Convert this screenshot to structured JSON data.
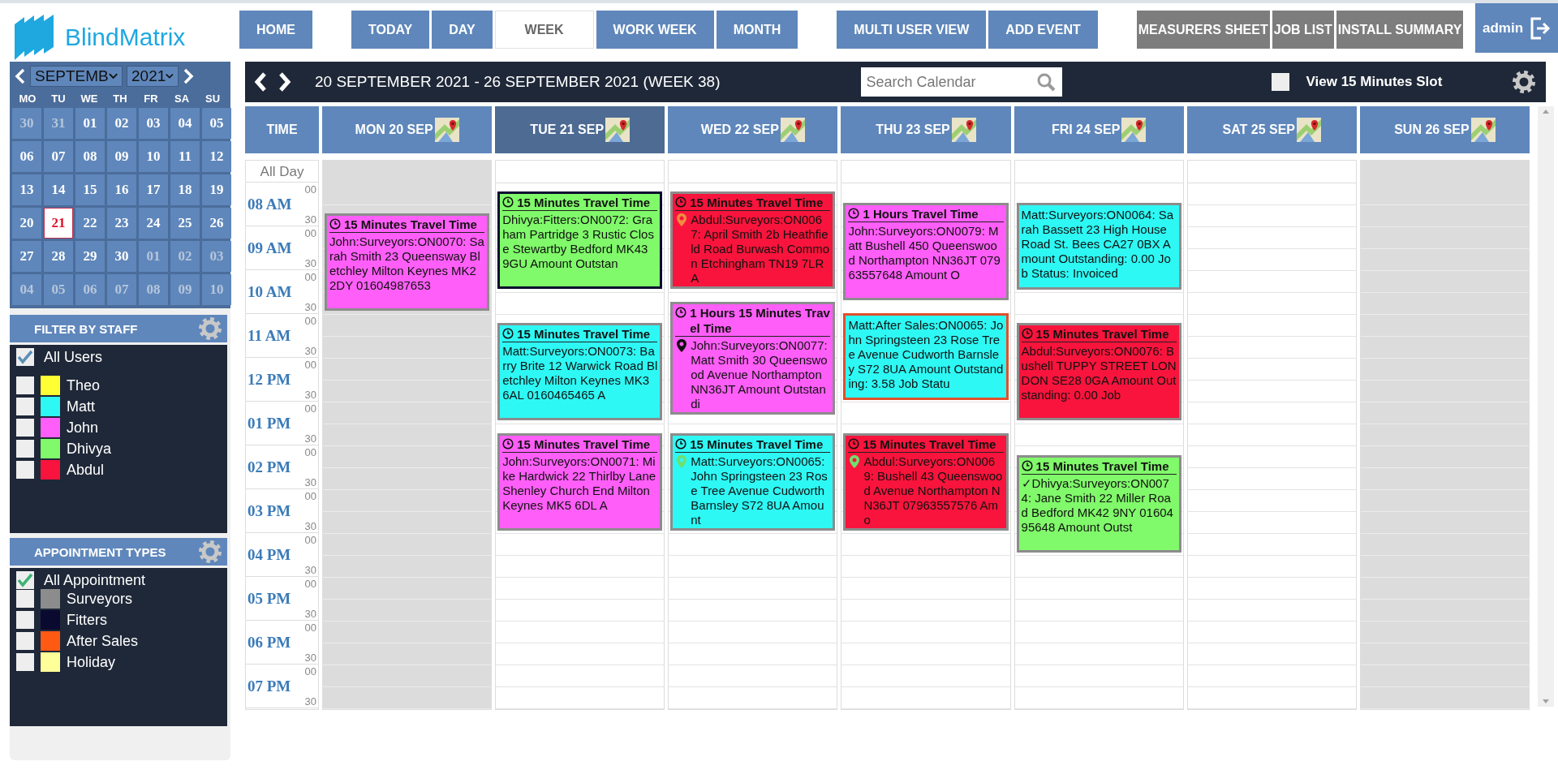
{
  "logo": {
    "text": "BlindMatrix"
  },
  "nav_groups": [
    {
      "kind": "primary",
      "buttons": [
        {
          "label": "HOME"
        }
      ]
    },
    {
      "kind": "views",
      "buttons": [
        {
          "label": "TODAY",
          "selected": false
        },
        {
          "label": "DAY",
          "selected": false
        },
        {
          "label": "WEEK",
          "selected": true
        },
        {
          "label": "WORK WEEK",
          "selected": false
        },
        {
          "label": "MONTH",
          "selected": false
        }
      ]
    },
    {
      "kind": "primary",
      "buttons": [
        {
          "label": "MULTI USER VIEW"
        },
        {
          "label": "ADD EVENT"
        }
      ]
    },
    {
      "kind": "report",
      "buttons": [
        {
          "label": "MEASURERS SHEET"
        },
        {
          "label": "JOB LIST"
        },
        {
          "label": "INSTALL SUMMARY"
        }
      ]
    }
  ],
  "user": {
    "name": "admin"
  },
  "mini_calendar": {
    "month": "SEPTEMB",
    "year": "2021",
    "weekdays": [
      "MO",
      "TU",
      "WE",
      "TH",
      "FR",
      "SA",
      "SU"
    ],
    "days": [
      {
        "label": "30",
        "other_month": true,
        "selected": false
      },
      {
        "label": "31",
        "other_month": true,
        "selected": false
      },
      {
        "label": "01",
        "other_month": false,
        "selected": false
      },
      {
        "label": "02",
        "other_month": false,
        "selected": false
      },
      {
        "label": "03",
        "other_month": false,
        "selected": false
      },
      {
        "label": "04",
        "other_month": false,
        "selected": false
      },
      {
        "label": "05",
        "other_month": false,
        "selected": false
      },
      {
        "label": "06",
        "other_month": false,
        "selected": false
      },
      {
        "label": "07",
        "other_month": false,
        "selected": false
      },
      {
        "label": "08",
        "other_month": false,
        "selected": false
      },
      {
        "label": "09",
        "other_month": false,
        "selected": false
      },
      {
        "label": "10",
        "other_month": false,
        "selected": false
      },
      {
        "label": "11",
        "other_month": false,
        "selected": false
      },
      {
        "label": "12",
        "other_month": false,
        "selected": false
      },
      {
        "label": "13",
        "other_month": false,
        "selected": false
      },
      {
        "label": "14",
        "other_month": false,
        "selected": false
      },
      {
        "label": "15",
        "other_month": false,
        "selected": false
      },
      {
        "label": "16",
        "other_month": false,
        "selected": false
      },
      {
        "label": "17",
        "other_month": false,
        "selected": false
      },
      {
        "label": "18",
        "other_month": false,
        "selected": false
      },
      {
        "label": "19",
        "other_month": false,
        "selected": false
      },
      {
        "label": "20",
        "other_month": false,
        "selected": false
      },
      {
        "label": "21",
        "other_month": false,
        "selected": true
      },
      {
        "label": "22",
        "other_month": false,
        "selected": false
      },
      {
        "label": "23",
        "other_month": false,
        "selected": false
      },
      {
        "label": "24",
        "other_month": false,
        "selected": false
      },
      {
        "label": "25",
        "other_month": false,
        "selected": false
      },
      {
        "label": "26",
        "other_month": false,
        "selected": false
      },
      {
        "label": "27",
        "other_month": false,
        "selected": false
      },
      {
        "label": "28",
        "other_month": false,
        "selected": false
      },
      {
        "label": "29",
        "other_month": false,
        "selected": false
      },
      {
        "label": "30",
        "other_month": false,
        "selected": false
      },
      {
        "label": "01",
        "other_month": true,
        "selected": false
      },
      {
        "label": "02",
        "other_month": true,
        "selected": false
      },
      {
        "label": "03",
        "other_month": true,
        "selected": false
      },
      {
        "label": "04",
        "other_month": true,
        "selected": false
      },
      {
        "label": "05",
        "other_month": true,
        "selected": false
      },
      {
        "label": "06",
        "other_month": true,
        "selected": false
      },
      {
        "label": "07",
        "other_month": true,
        "selected": false
      },
      {
        "label": "08",
        "other_month": true,
        "selected": false
      },
      {
        "label": "09",
        "other_month": true,
        "selected": false
      },
      {
        "label": "10",
        "other_month": true,
        "selected": false
      }
    ]
  },
  "staff_filter": {
    "title": "FILTER BY STAFF",
    "all": {
      "label": "All Users",
      "checked": true
    },
    "items": [
      {
        "name": "Theo",
        "color": "#ffff33",
        "checked": false
      },
      {
        "name": "Matt",
        "color": "#2ef8f4",
        "checked": false
      },
      {
        "name": "John",
        "color": "#ff5ef8",
        "checked": false
      },
      {
        "name": "Dhivya",
        "color": "#80f96a",
        "checked": false
      },
      {
        "name": "Abdul",
        "color": "#f8143c",
        "checked": false
      }
    ]
  },
  "appointment_types": {
    "title": "APPOINTMENT TYPES",
    "all": {
      "label": "All Appointment",
      "checked": true
    },
    "items": [
      {
        "name": "Surveyors",
        "color": "#8c8c8c",
        "checked": false
      },
      {
        "name": "Fitters",
        "color": "#0a0a30",
        "checked": false
      },
      {
        "name": "After Sales",
        "color": "#ff5a14",
        "checked": false
      },
      {
        "name": "Holiday",
        "color": "#ffff99",
        "checked": false
      }
    ]
  },
  "toolbar": {
    "range": "20 SEPTEMBER 2021 - 26 SEPTEMBER 2021 (WEEK 38)",
    "search": {
      "placeholder": "Search Calendar"
    },
    "slot_toggle": {
      "label": "View 15 Minutes Slot",
      "checked": false
    }
  },
  "calendar": {
    "time_heading": "TIME",
    "all_day_label": "All Day",
    "hours": [
      {
        "label": "08 AM",
        "marks": [
          "00",
          "30"
        ]
      },
      {
        "label": "09 AM",
        "marks": [
          "00",
          "30"
        ]
      },
      {
        "label": "10 AM",
        "marks": [
          "00",
          "30"
        ]
      },
      {
        "label": "11 AM",
        "marks": [
          "00",
          "30"
        ]
      },
      {
        "label": "12 PM",
        "marks": [
          "00",
          "30"
        ]
      },
      {
        "label": "01 PM",
        "marks": [
          "00",
          "30"
        ]
      },
      {
        "label": "02 PM",
        "marks": [
          "00",
          "30"
        ]
      },
      {
        "label": "03 PM",
        "marks": [
          "00",
          "30"
        ]
      },
      {
        "label": "04 PM",
        "marks": [
          "00",
          "30"
        ]
      },
      {
        "label": "05 PM",
        "marks": [
          "00",
          "30"
        ]
      },
      {
        "label": "06 PM",
        "marks": [
          "00",
          "30"
        ]
      },
      {
        "label": "07 PM",
        "marks": [
          "00",
          "30"
        ]
      }
    ],
    "days": [
      {
        "label": "MON 20 SEP",
        "selected": false,
        "shaded": true,
        "events": [
          {
            "color": "#ff5ef8",
            "outline": {
              "color": "#8c8c8c"
            },
            "title": "15 Minutes Travel Time",
            "text": "John:Surveyors:ON0070: Sarah Smith 23 Queensway Bletchley Milton Keynes MK2 2DY 01604987653"
          }
        ]
      },
      {
        "label": "TUE 21 SEP",
        "selected": true,
        "shaded": false,
        "events": [
          {
            "color": "#80f96a",
            "outline": {
              "color": "#0a0a30"
            },
            "title": "15 Minutes Travel Time",
            "text": "Dhivya:Fitters:ON0072: Graham Partridge 3 Rustic Close Stewartby Bedford MK43 9GU Amount Outstan"
          },
          {
            "color": "#2ef8f4",
            "outline": {
              "color": "#8c8c8c"
            },
            "title": "15 Minutes Travel Time",
            "text": "Matt:Surveyors:ON0073: Barry Brite 12 Warwick Road Bletchley Milton Keynes MK3 6AL 0160465465 A"
          },
          {
            "color": "#ff5ef8",
            "outline": {
              "color": "#8c8c8c"
            },
            "title": "15 Minutes Travel Time",
            "text": "John:Surveyors:ON0071: Mike Hardwick 22 Thirlby Lane Shenley Church End Milton Keynes MK5 6DL A"
          }
        ]
      },
      {
        "label": "WED 22 SEP",
        "selected": false,
        "shaded": false,
        "events": [
          {
            "color": "#f8143c",
            "outline": {
              "color": "#8c8c8c"
            },
            "title": "15 Minutes Travel Time",
            "pin": {
              "color": "#f08a40"
            },
            "text": "Abdul:Surveyors:ON0067: April Smith 2b Heathfield Road Burwash Common Etchingham TN19 7LR A"
          },
          {
            "color": "#ff5ef8",
            "outline": {
              "color": "#8c8c8c"
            },
            "title": "1 Hours 15 Minutes Travel Time",
            "pin": {
              "color": "#111111"
            },
            "text": "John:Surveyors:ON0077: Matt Smith 30 Queenswood Avenue Northampton NN36JT Amount Outstandi"
          },
          {
            "color": "#2ef8f4",
            "outline": {
              "color": "#8c8c8c"
            },
            "title": "15 Minutes Travel Time",
            "pin": {
              "color": "#6fe06f"
            },
            "text": "Matt:Surveyors:ON0065: John Springsteen 23 Rose Tree Avenue Cudworth Barnsley S72 8UA Amount"
          }
        ]
      },
      {
        "label": "THU 23 SEP",
        "selected": false,
        "shaded": false,
        "events": [
          {
            "color": "#ff5ef8",
            "outline": {
              "color": "#8c8c8c"
            },
            "title": "1 Hours Travel Time",
            "text": "John:Surveyors:ON0079: Matt Bushell 450 Queenswood Northampton NN36JT 07963557648 Amount O"
          },
          {
            "color": "#2ef8f4",
            "outline": {
              "color": "#e0502a"
            },
            "text": "Matt:After Sales:ON0065: John Springsteen 23 Rose Tree Avenue Cudworth Barnsley S72 8UA Amount Outstanding: 3.58 Job Statu"
          },
          {
            "color": "#f8143c",
            "outline": {
              "color": "#8c8c8c"
            },
            "title": "15 Minutes Travel Time",
            "pin": {
              "color": "#6fe06f"
            },
            "text": "Abdul:Surveyors:ON0069: Bushell 43 Queenswood Avenue Northampton NN36JT 07963557576 Amo"
          }
        ]
      },
      {
        "label": "FRI 24 SEP",
        "selected": false,
        "shaded": false,
        "events": [
          {
            "color": "#2ef8f4",
            "outline": {
              "color": "#8c8c8c"
            },
            "text": "Matt:Surveyors:ON0064: Sarah Bassett 23 High House Road St. Bees CA27 0BX Amount Outstanding: 0.00 Job Status: Invoiced"
          },
          {
            "color": "#f8143c",
            "outline": {
              "color": "#8c8c8c"
            },
            "title": "15 Minutes Travel Time",
            "text": "Abdul:Surveyors:ON0076: Bushell TUPPY STREET LONDON SE28 0GA Amount Outstanding: 0.00 Job"
          },
          {
            "color": "#80f96a",
            "outline": {
              "color": "#8c8c8c"
            },
            "title": "15 Minutes Travel Time",
            "text": "✓Dhivya:Surveyors:ON0074: Jane Smith 22 Miller Road Bedford MK42 9NY 0160495648 Amount Outst"
          }
        ]
      },
      {
        "label": "SAT 25 SEP",
        "selected": false,
        "shaded": false
      },
      {
        "label": "SUN 26 SEP",
        "selected": false,
        "shaded": true
      }
    ]
  }
}
